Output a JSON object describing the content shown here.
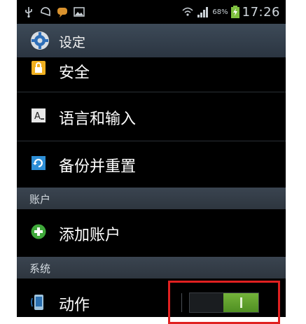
{
  "status_bar": {
    "battery_percent": "68%",
    "time": "17:26",
    "icons": [
      "usb-icon",
      "sync-icon",
      "chat-icon",
      "image-icon",
      "wifi-icon",
      "signal-icon",
      "battery-icon"
    ]
  },
  "title_bar": {
    "title": "设定",
    "icon": "gear-icon"
  },
  "items": [
    {
      "label": "安全",
      "icon": "lock-icon"
    },
    {
      "label": "语言和输入",
      "icon": "keyboard-icon"
    },
    {
      "label": "备份并重置",
      "icon": "backup-icon"
    }
  ],
  "sections": [
    {
      "label": "账户"
    },
    {
      "label": "系统"
    }
  ],
  "account_items": [
    {
      "label": "添加账户",
      "icon": "add-icon"
    }
  ],
  "system_items": [
    {
      "label": "动作",
      "icon": "phone-icon",
      "toggle_state": "on"
    }
  ],
  "colors": {
    "toggle_on": "#5fa12d",
    "highlight_border": "#e02020",
    "section_background": "#343d47"
  }
}
